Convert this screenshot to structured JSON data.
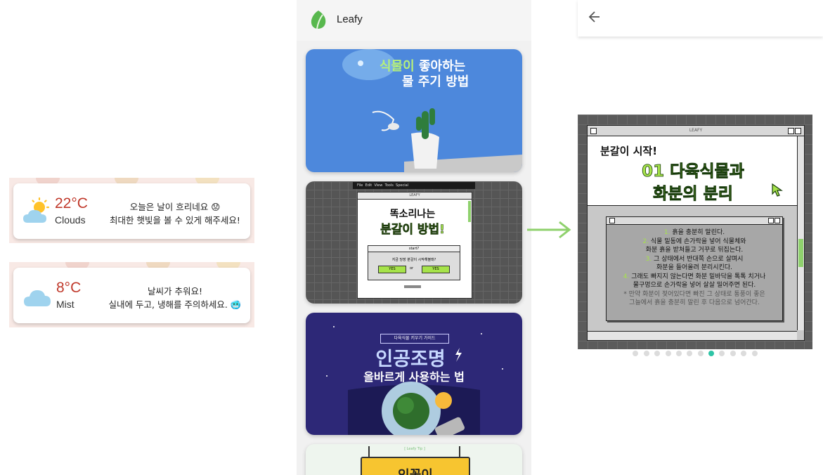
{
  "weather": [
    {
      "temp": "22°C",
      "condition": "Clouds",
      "message_line1": "오늘은 날이 흐리네요",
      "message_line2": "최대한 햇빛을 볼 수 있게 해주세요!",
      "emoji": "😟",
      "icon": "sun-cloud-icon"
    },
    {
      "temp": "8°C",
      "condition": "Mist",
      "message_line1": "날씨가 추워요!",
      "message_line2": "실내에 두고, 냉해를 주의하세요.",
      "emoji": "🥶",
      "icon": "cloud-icon"
    }
  ],
  "leafy": {
    "app_title": "Leafy",
    "cards": [
      {
        "title_hl": "식물이",
        "title_rest": " 좋아하는",
        "title_line2": "물 주기 방법"
      },
      {
        "menu": [
          "File",
          "Edit",
          "View",
          "Tools",
          "Special"
        ],
        "window_title": "LEAFY",
        "title_line1": "똑소리나는",
        "title_line2": "분갈이 방법!",
        "dialog_title": "start?",
        "dialog_text": "지금 당장 분갈이 시작해볼래?",
        "yes1": "YES",
        "or": "or",
        "yes2": "YES"
      },
      {
        "tag": "다육식물 키우기 가이드",
        "title_line1": "인공조명",
        "title_line2": "올바르게 사용하는 법"
      },
      {
        "top_label": "[ Leafy Tip ]",
        "title": "인꽃이"
      }
    ]
  },
  "detail": {
    "window_title": "LEAFY",
    "heading_small": "분갈이 시작!",
    "heading_line1": "01 다육식물과",
    "heading_line2": "화분의 분리",
    "steps": [
      {
        "num": "1.",
        "text": "흙을 충분히 말린다."
      },
      {
        "num": "2.",
        "text": "식물 밑동에 손가락을 넣어 식물체와"
      },
      {
        "num": "",
        "text": "화분 흙을 받쳐들고 거꾸로 뒤집는다."
      },
      {
        "num": "3.",
        "text": "그 상태에서 반대쪽 손으로 살며시"
      },
      {
        "num": "",
        "text": "화분을 들어올려 분리시킨다."
      },
      {
        "num": "4.",
        "text": "그래도 빠지지 않는다면 화분 밑바닥을 톡톡 치거나"
      },
      {
        "num": "",
        "text": "물구멍으로 손가락을 넣어 살살 밀어주면 된다."
      }
    ],
    "note_line1": "* 만약 화분이 젖어있다면 빠진 그 상태로 통풍이 좋은",
    "note_line2": "그늘에서 흙을 충분히 말린 후 다음으로 넘어간다.",
    "page_count": 12,
    "active_page": 8
  },
  "colors": {
    "accent_green": "#8fd16d",
    "pixel_green": "#a6e34a",
    "temp_red": "#c0392b"
  }
}
